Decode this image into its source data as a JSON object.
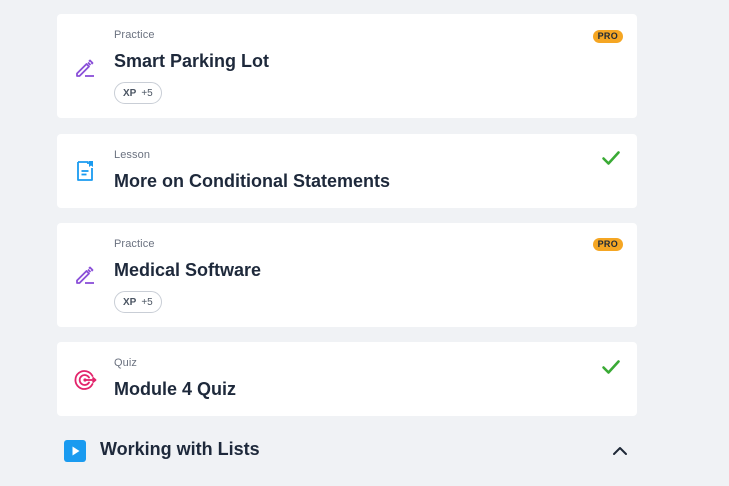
{
  "items": [
    {
      "type": "Practice",
      "title": "Smart Parking Lot",
      "icon": "pencil-icon",
      "badge": "PRO",
      "xp_label": "XP",
      "xp_value": "+5",
      "completed": false
    },
    {
      "type": "Lesson",
      "title": "More on Conditional Statements",
      "icon": "lesson-document-icon",
      "completed": true
    },
    {
      "type": "Practice",
      "title": "Medical Software",
      "icon": "pencil-icon",
      "badge": "PRO",
      "xp_label": "XP",
      "xp_value": "+5",
      "completed": false
    },
    {
      "type": "Quiz",
      "title": "Module 4 Quiz",
      "icon": "target-icon",
      "completed": true
    }
  ],
  "section": {
    "title": "Working with Lists",
    "icon": "play-icon",
    "expanded": true
  },
  "colors": {
    "practice_icon": "#8a4fd8",
    "lesson_icon": "#1a9bf0",
    "quiz_icon": "#e2246b",
    "check": "#3aaa35",
    "pro_badge": "#f5a623",
    "background": "#f0f2f5"
  }
}
